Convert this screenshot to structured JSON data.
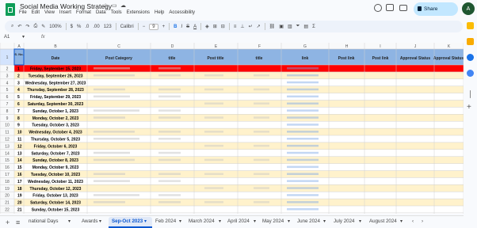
{
  "doc_title": "Social Media Working Strategy",
  "menus": [
    "File",
    "Edit",
    "View",
    "Insert",
    "Format",
    "Data",
    "Tools",
    "Extensions",
    "Help",
    "Accessibility"
  ],
  "share_label": "Share",
  "avatar_initial": "A",
  "toolbar": {
    "zoom": "100%",
    "currency": "$",
    "percent": "%",
    "dec_dec": ".0",
    "dec_inc": ".00",
    "num_format": "123",
    "font": "Calibri",
    "font_size": "9",
    "bold": "B",
    "italic": "I",
    "strike": "S",
    "text_color": "A"
  },
  "name_box": "A1",
  "fx": "fx",
  "columns": [
    "A",
    "B",
    "C",
    "D",
    "E",
    "F",
    "G",
    "H",
    "I",
    "J",
    "K"
  ],
  "headers": {
    "a": "S. No.",
    "date": "Date",
    "category": "Post Category",
    "title_label": "title",
    "post_title": "Post title",
    "link": "link",
    "post_link": "Post link",
    "approval": "Approval Status"
  },
  "rows": [
    {
      "num": "1",
      "a": "",
      "date": "",
      "highlight": "header"
    },
    {
      "num": "2",
      "a": "1",
      "date": "Friday, September 15, 2023",
      "highlight": "red"
    },
    {
      "num": "3",
      "a": "2",
      "date": "Tuesday, September 26, 2023"
    },
    {
      "num": "4",
      "a": "3",
      "date": "Wednesday, September 27, 2023"
    },
    {
      "num": "5",
      "a": "4",
      "date": "Thursday, September 28, 2023"
    },
    {
      "num": "6",
      "a": "5",
      "date": "Friday, September 29, 2023"
    },
    {
      "num": "7",
      "a": "6",
      "date": "Saturday, September 30, 2023"
    },
    {
      "num": "8",
      "a": "7",
      "date": "Sunday, October 1, 2023"
    },
    {
      "num": "9",
      "a": "8",
      "date": "Monday, October 2, 2023"
    },
    {
      "num": "10",
      "a": "9",
      "date": "Tuesday, October 3, 2023"
    },
    {
      "num": "11",
      "a": "10",
      "date": "Wednesday, October 4, 2023"
    },
    {
      "num": "12",
      "a": "11",
      "date": "Thursday, October 5, 2023"
    },
    {
      "num": "13",
      "a": "12",
      "date": "Friday, October 6, 2023"
    },
    {
      "num": "14",
      "a": "13",
      "date": "Saturday, October 7, 2023"
    },
    {
      "num": "15",
      "a": "14",
      "date": "Sunday, October 8, 2023"
    },
    {
      "num": "16",
      "a": "15",
      "date": "Monday, October 9, 2023"
    },
    {
      "num": "17",
      "a": "16",
      "date": "Tuesday, October 10, 2023"
    },
    {
      "num": "18",
      "a": "17",
      "date": "Wednesday, October 11, 2023"
    },
    {
      "num": "19",
      "a": "18",
      "date": "Thursday, October 12, 2023"
    },
    {
      "num": "20",
      "a": "19",
      "date": "Friday, October 13, 2023"
    },
    {
      "num": "21",
      "a": "20",
      "date": "Saturday, October 14, 2023"
    },
    {
      "num": "22",
      "a": "21",
      "date": "Sunday, October 15, 2023"
    }
  ],
  "sheet_tabs": [
    "national Days",
    "Awards",
    "Sep-Oct 2023",
    "Feb 2024",
    "March 2024",
    "April 2024",
    "May 2024",
    "June 2024",
    "July 2024",
    "August 2024"
  ],
  "active_tab": "Sep-Oct 2023",
  "colors": {
    "header_fill": "#8eb4e3",
    "row_band": "#fff2cc",
    "red": "#ff0000",
    "accent": "#0b57d0"
  }
}
